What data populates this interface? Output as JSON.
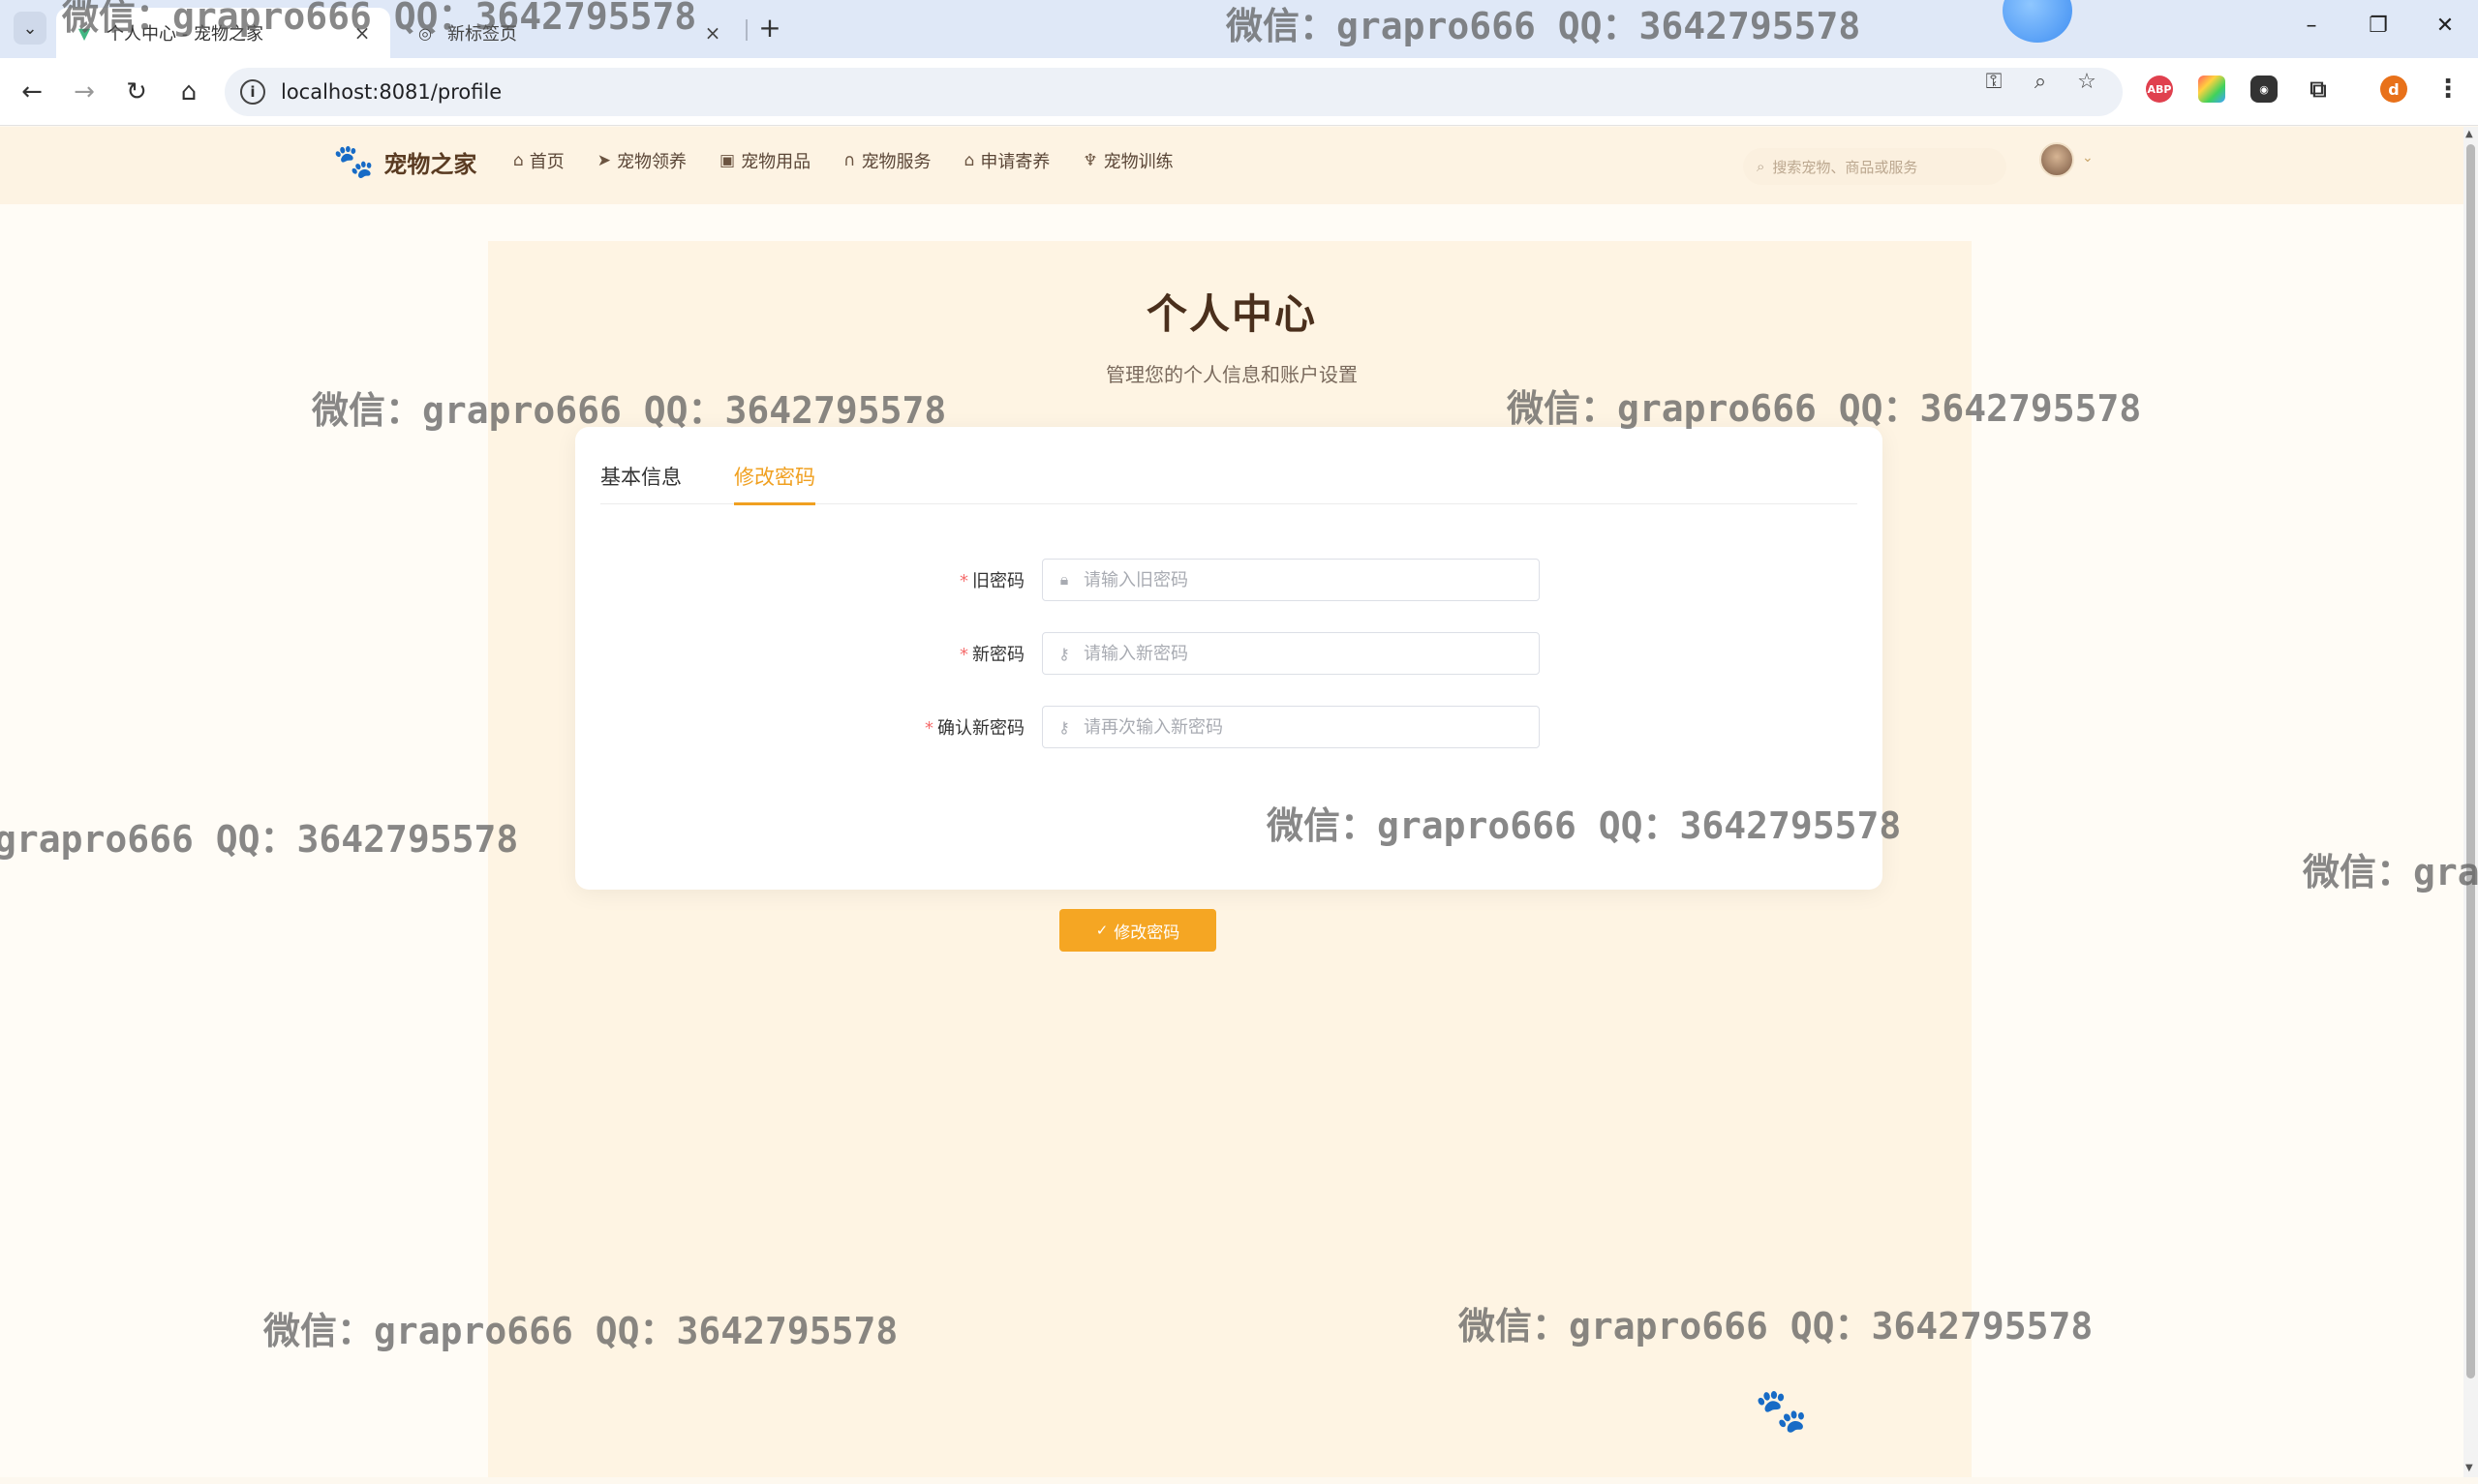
{
  "browser": {
    "tabs": [
      {
        "title": "个人中心 - 宠物之家",
        "active": true
      },
      {
        "title": "新标签页",
        "active": false
      }
    ],
    "url": "localhost:8081/profile",
    "profile_initial": "d",
    "abp_label": "ABP"
  },
  "site": {
    "brand": "宠物之家",
    "nav": [
      {
        "label": "首页",
        "icon": "home-icon"
      },
      {
        "label": "宠物领养",
        "icon": "send-icon"
      },
      {
        "label": "宠物用品",
        "icon": "bag-icon"
      },
      {
        "label": "宠物服务",
        "icon": "headset-icon"
      },
      {
        "label": "申请寄养",
        "icon": "house-icon"
      },
      {
        "label": "宠物训练",
        "icon": "trophy-icon"
      }
    ],
    "search_placeholder": "搜索宠物、商品或服务"
  },
  "profile": {
    "title": "个人中心",
    "subtitle": "管理您的个人信息和账户设置",
    "tabs": [
      {
        "label": "基本信息",
        "active": false
      },
      {
        "label": "修改密码",
        "active": true
      }
    ],
    "form": {
      "old_password": {
        "label": "旧密码",
        "placeholder": "请输入旧密码"
      },
      "new_password": {
        "label": "新密码",
        "placeholder": "请输入新密码"
      },
      "confirm_password": {
        "label": "确认新密码",
        "placeholder": "请再次输入新密码"
      },
      "required_mark": "*",
      "submit_label": "修改密码"
    }
  },
  "watermark_text": "微信：grapro666 QQ：3642795578",
  "colors": {
    "accent": "#f0a020",
    "button": "#f5a623",
    "brand_text": "#5a3b22",
    "header_bg": "#fdf3e3"
  }
}
